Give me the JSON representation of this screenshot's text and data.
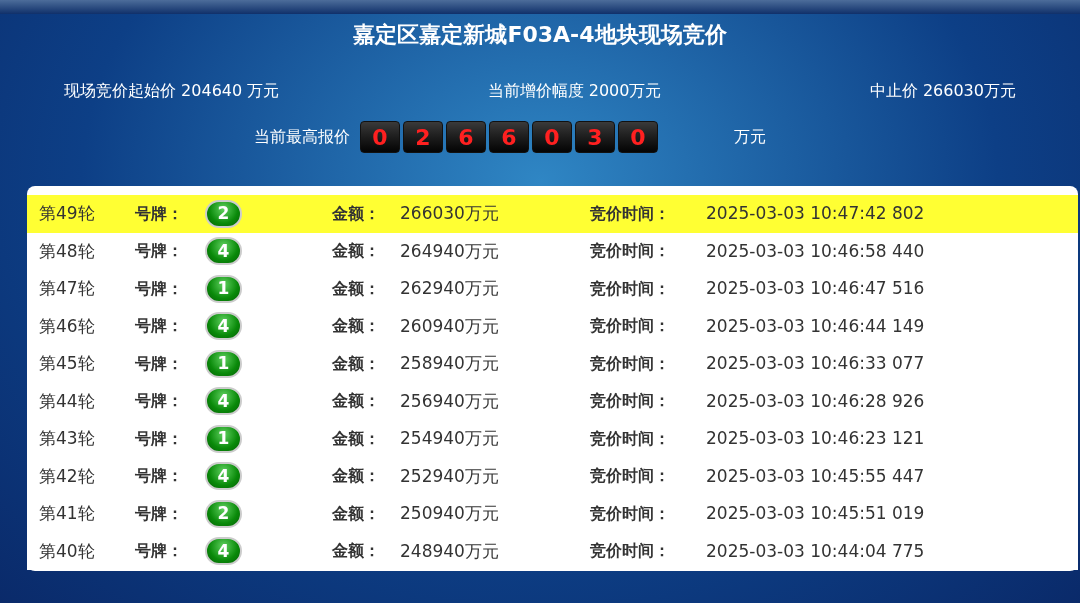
{
  "title": "嘉定区嘉定新城F03A-4地块现场竞价",
  "summary": [
    {
      "text": "现场竞价起始价 204640 万元"
    },
    {
      "text": "当前增价幅度 2000万元"
    },
    {
      "text": "中止价 266030万元"
    }
  ],
  "highest_bid": {
    "label": "当前最高报价",
    "digits": [
      "0",
      "2",
      "6",
      "6",
      "0",
      "3",
      "0"
    ],
    "unit": "万元"
  },
  "rows": [
    {
      "round": "第49轮",
      "plate_label": "号牌：",
      "plate": "2",
      "amount_label": "金额：",
      "amount": "266030万元",
      "time_label": "竞价时间：",
      "time": "2025-03-03 10:47:42 802",
      "selected": true
    },
    {
      "round": "第48轮",
      "plate_label": "号牌：",
      "plate": "4",
      "amount_label": "金额：",
      "amount": "264940万元",
      "time_label": "竞价时间：",
      "time": "2025-03-03 10:46:58 440",
      "selected": false
    },
    {
      "round": "第47轮",
      "plate_label": "号牌：",
      "plate": "1",
      "amount_label": "金额：",
      "amount": "262940万元",
      "time_label": "竞价时间：",
      "time": "2025-03-03 10:46:47 516",
      "selected": false
    },
    {
      "round": "第46轮",
      "plate_label": "号牌：",
      "plate": "4",
      "amount_label": "金额：",
      "amount": "260940万元",
      "time_label": "竞价时间：",
      "time": "2025-03-03 10:46:44 149",
      "selected": false
    },
    {
      "round": "第45轮",
      "plate_label": "号牌：",
      "plate": "1",
      "amount_label": "金额：",
      "amount": "258940万元",
      "time_label": "竞价时间：",
      "time": "2025-03-03 10:46:33 077",
      "selected": false
    },
    {
      "round": "第44轮",
      "plate_label": "号牌：",
      "plate": "4",
      "amount_label": "金额：",
      "amount": "256940万元",
      "time_label": "竞价时间：",
      "time": "2025-03-03 10:46:28 926",
      "selected": false
    },
    {
      "round": "第43轮",
      "plate_label": "号牌：",
      "plate": "1",
      "amount_label": "金额：",
      "amount": "254940万元",
      "time_label": "竞价时间：",
      "time": "2025-03-03 10:46:23 121",
      "selected": false
    },
    {
      "round": "第42轮",
      "plate_label": "号牌：",
      "plate": "4",
      "amount_label": "金额：",
      "amount": "252940万元",
      "time_label": "竞价时间：",
      "time": "2025-03-03 10:45:55 447",
      "selected": false
    },
    {
      "round": "第41轮",
      "plate_label": "号牌：",
      "plate": "2",
      "amount_label": "金额：",
      "amount": "250940万元",
      "time_label": "竞价时间：",
      "time": "2025-03-03 10:45:51 019",
      "selected": false
    },
    {
      "round": "第40轮",
      "plate_label": "号牌：",
      "plate": "4",
      "amount_label": "金额：",
      "amount": "248940万元",
      "time_label": "竞价时间：",
      "time": "2025-03-03 10:44:04 775",
      "selected": false
    }
  ]
}
